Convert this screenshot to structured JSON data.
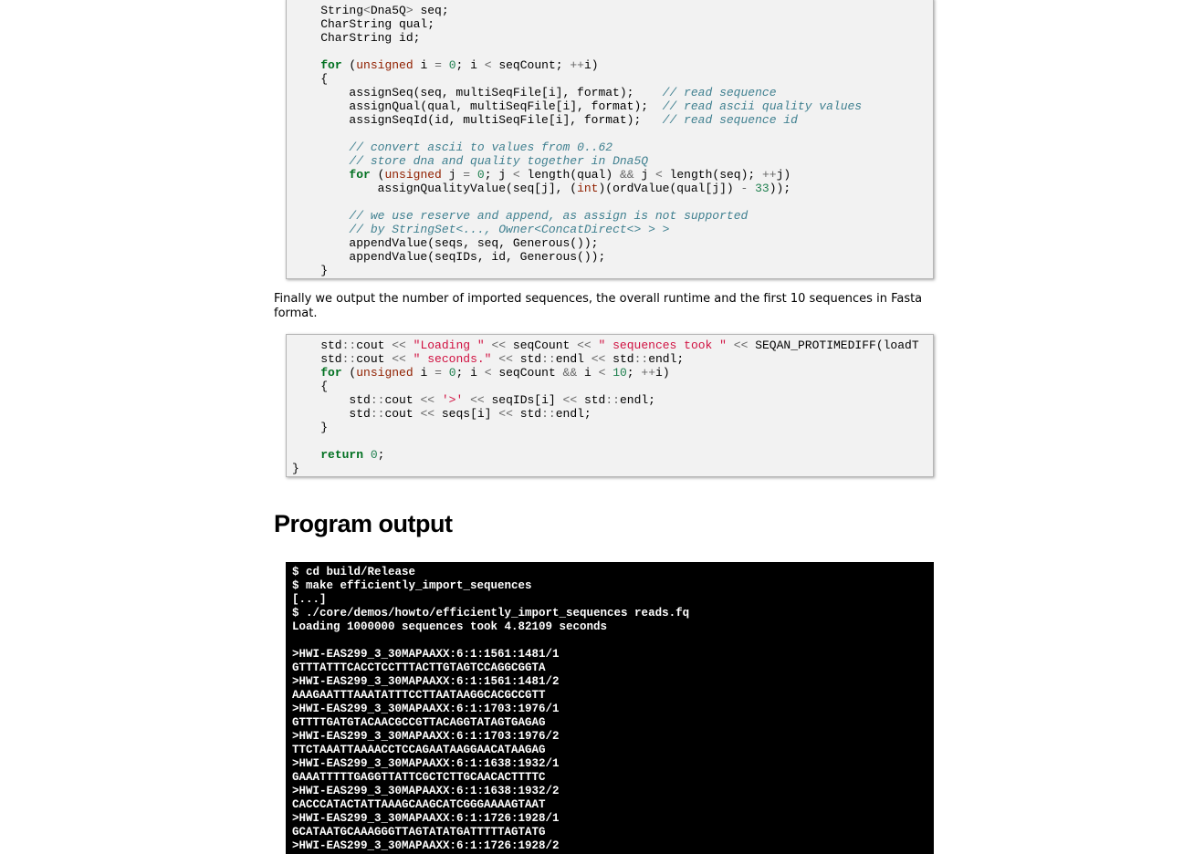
{
  "code_block_1": {
    "lines": [
      "    String<Dna5Q> seq;",
      "    CharString qual;",
      "    CharString id;",
      "",
      "    for (unsigned i = 0; i < seqCount; ++i)",
      "    {",
      "        assignSeq(seq, multiSeqFile[i], format);    // read sequence",
      "        assignQual(qual, multiSeqFile[i], format);  // read ascii quality values",
      "        assignSeqId(id, multiSeqFile[i], format);   // read sequence id",
      "",
      "        // convert ascii to values from 0..62",
      "        // store dna and quality together in Dna5Q",
      "        for (unsigned j = 0; j < length(qual) && j < length(seq); ++j)",
      "            assignQualityValue(seq[j], (int)(ordValue(qual[j]) - 33));",
      "",
      "        // we use reserve and append, as assign is not supported",
      "        // by StringSet<..., Owner<ConcatDirect<> > >",
      "        appendValue(seqs, seq, Generous());",
      "        appendValue(seqIDs, id, Generous());",
      "    }"
    ]
  },
  "paragraph": "Finally we output the number of imported sequences, the overall runtime and the first 10 sequences in Fasta format.",
  "code_block_2": {
    "lines": [
      "    std::cout << \"Loading \" << seqCount << \" sequences took \" << SEQAN_PROTIMEDIFF(loadT",
      "    std::cout << \" seconds.\" << std::endl << std::endl;",
      "    for (unsigned i = 0; i < seqCount && i < 10; ++i)",
      "    {",
      "        std::cout << '>' << seqIDs[i] << std::endl;",
      "        std::cout << seqs[i] << std::endl;",
      "    }",
      "",
      "    return 0;",
      "}"
    ]
  },
  "section_title": "Program output",
  "terminal": {
    "lines": [
      "$ cd build/Release",
      "$ make efficiently_import_sequences",
      "[...]",
      "$ ./core/demos/howto/efficiently_import_sequences reads.fq",
      "Loading 1000000 sequences took 4.82109 seconds",
      "",
      ">HWI-EAS299_3_30MAPAAXX:6:1:1561:1481/1",
      "GTTTATTTCACCTCCTTTACTTGTAGTCCAGGCGGTA",
      ">HWI-EAS299_3_30MAPAAXX:6:1:1561:1481/2",
      "AAAGAATTTAAATATTTCCTTAATAAGGCACGCCGTT",
      ">HWI-EAS299_3_30MAPAAXX:6:1:1703:1976/1",
      "GTTTTGATGTACAACGCCGTTACAGGTATAGTGAGAG",
      ">HWI-EAS299_3_30MAPAAXX:6:1:1703:1976/2",
      "TTCTAAATTAAAACCTCCAGAATAAGGAACATAAGAG",
      ">HWI-EAS299_3_30MAPAAXX:6:1:1638:1932/1",
      "GAAATTTTTGAGGTTATTCGCTCTTGCAACACTTTTC",
      ">HWI-EAS299_3_30MAPAAXX:6:1:1638:1932/2",
      "CACCCATACTATTAAAGCAAGCATCGGGAAAAGTAAT",
      ">HWI-EAS299_3_30MAPAAXX:6:1:1726:1928/1",
      "GCATAATGCAAAGGGTTAGTATATGATTTTTAGTATG",
      ">HWI-EAS299_3_30MAPAAXX:6:1:1726:1928/2"
    ]
  }
}
